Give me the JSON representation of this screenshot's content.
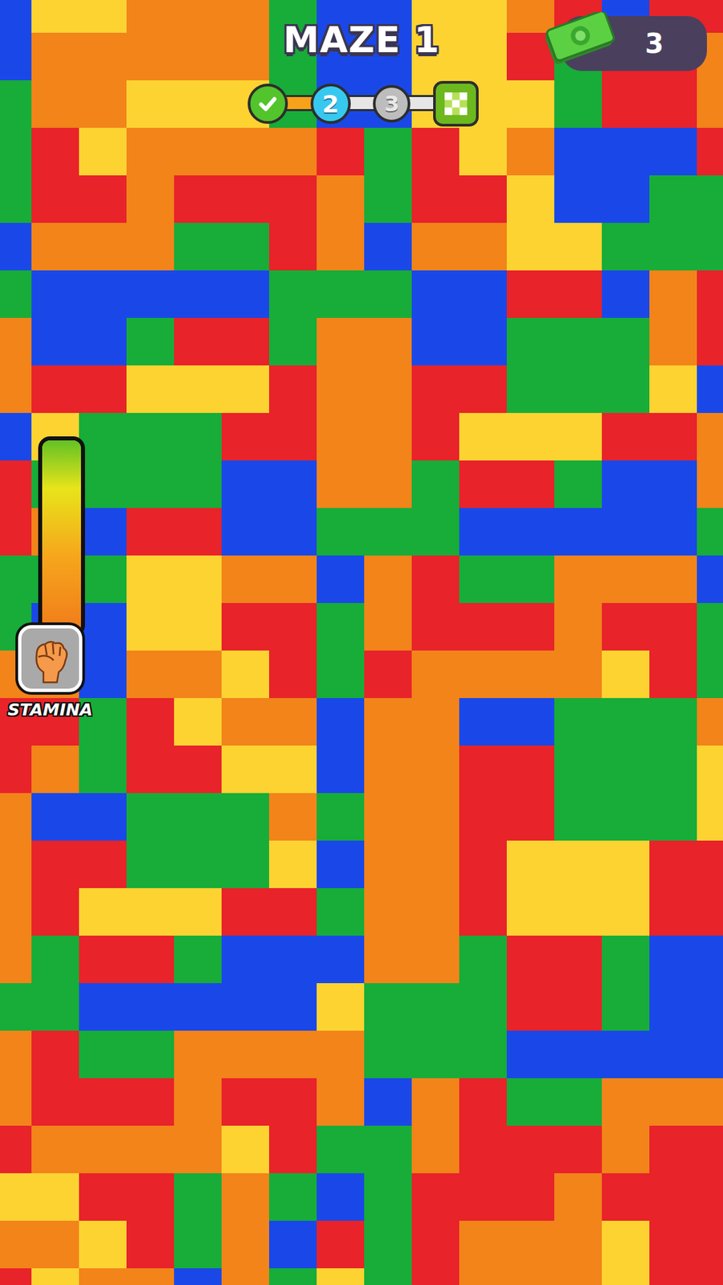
{
  "header": {
    "title": "MAZE 1"
  },
  "cash": {
    "amount": "3"
  },
  "progress": {
    "level": 0.33,
    "steps": [
      {
        "kind": "done",
        "selected": false
      },
      {
        "kind": "current",
        "label": "2",
        "selected": true
      },
      {
        "kind": "pending",
        "label": "3",
        "selected": false
      },
      {
        "kind": "finish",
        "selected": false
      }
    ]
  },
  "stamina": {
    "label": "STAMINA",
    "level": 1
  },
  "board": {
    "rows": [
      "BYYOOOGBBYYORBRR",
      "BOOOOOGBBYYRGRRO",
      "GOOYYYGBBYYYGRRO",
      "GRYOOOORGRYOBBBR",
      "GRRORRROGRRYBBGG",
      "BOOOGGROBOOYYGGG",
      "GBBBBBGGGBBRRBOR",
      "OBBGRRGOOBBGGGOR",
      "ORRYYYROORRGGGYB",
      "BYGGGRROORYYYRRO",
      "RGGGGBBOOGRRGBBO",
      "ROBRRBBGGGBBBBBG",
      "GGGYYOOBORGGOOOB",
      "GBBYYRRGORRRORRG",
      "OOBOOYRGROOOOYRG",
      "RRGRYOOBOOBBGGGO",
      "ROGRRYYBOORRGGGY",
      "OBBGGGOGOORRGGGY",
      "ORRGGGYBOORYYYRR",
      "ORYYYRRGOORYYYRR",
      "OGRRGBBBOOGRRGBB",
      "GGBBBBBYGGGRRGBB",
      "ORGGOOOOGGGBBBBB",
      "ORRRORROBORGGOOO",
      "ROOOOYRGGORRRORR",
      "YYRRGOGBGRRRORRR",
      "OOYRGOBRGROOOYRR",
      "RYOOBOGYGROOOYRR"
    ]
  }
}
